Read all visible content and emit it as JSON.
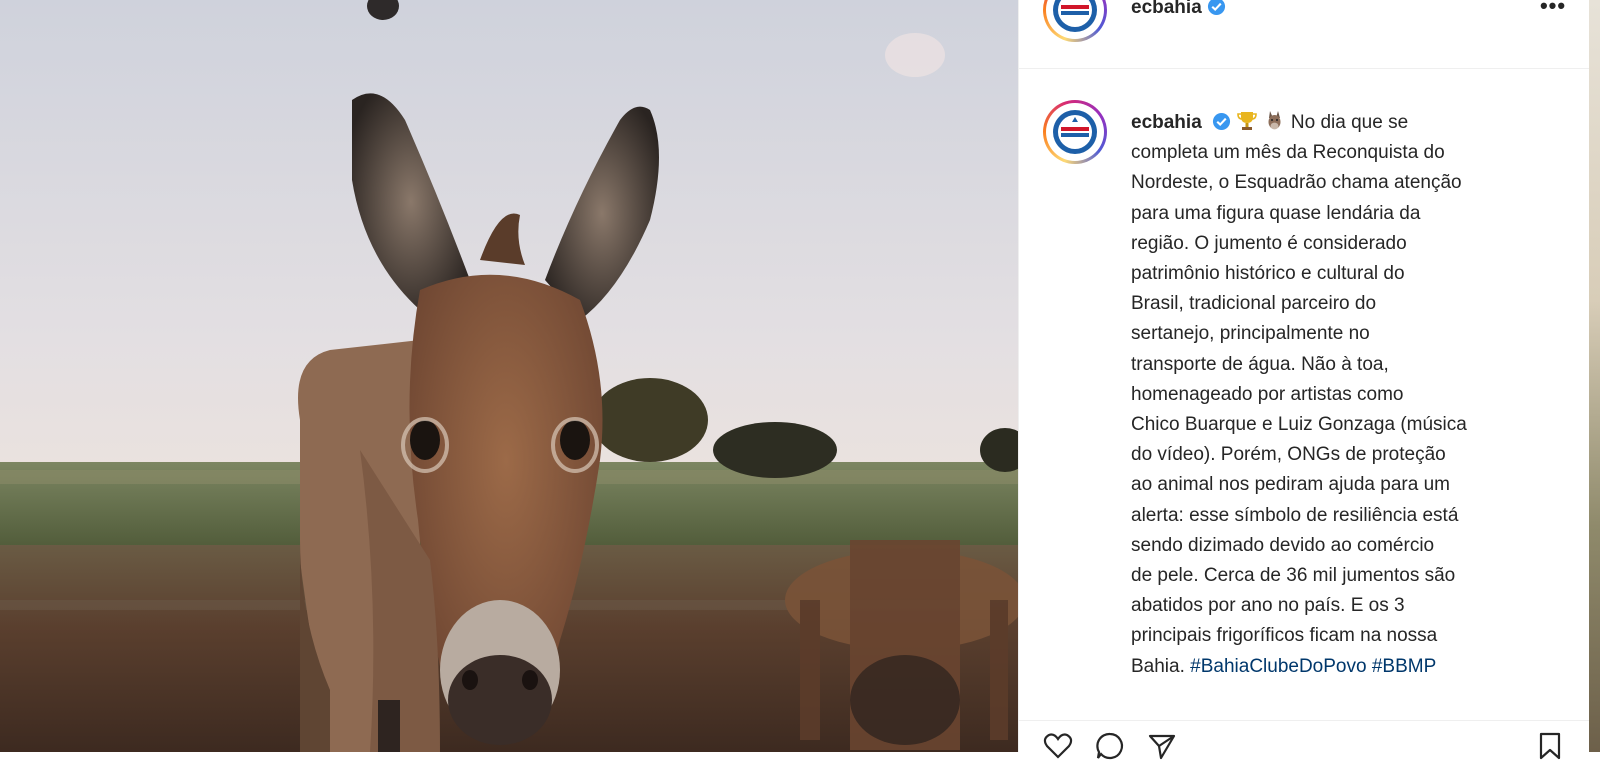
{
  "post": {
    "image_subject": "donkey-photo",
    "account": {
      "username": "ecbahia",
      "verified": true
    },
    "caption": {
      "username": "ecbahia",
      "emojis": [
        "trophy",
        "donkey"
      ],
      "lines": [
        "No dia que se",
        "completa um mês da Reconquista do",
        "Nordeste, o Esquadrão chama atenção",
        "para uma figura quase lendária da",
        "região. O jumento é considerado",
        "patrimônio histórico e cultural do",
        "Brasil, tradicional parceiro do",
        "sertanejo, principalmente no",
        "transporte de água. Não à toa,",
        "homenageado por artistas como",
        "Chico Buarque e Luiz Gonzaga (música",
        "do vídeo). Porém, ONGs de proteção",
        "ao animal nos pediram ajuda para um",
        "alerta: esse símbolo de resiliência está",
        "sendo dizimado devido ao comércio",
        "de pele. Cerca de 36 mil jumentos são",
        "abatidos por ano no país. E os 3",
        "principais frigoríficos ficam na nossa",
        "Bahia."
      ],
      "hashtags": [
        "#BahiaClubeDoPovo",
        "#BBMP"
      ]
    },
    "actions": [
      "heart-icon",
      "comment-icon",
      "share-icon",
      "bookmark-icon"
    ],
    "more_label": "•••"
  },
  "colors": {
    "verified_blue": "#3897f0",
    "hashtag": "#00376b",
    "text": "#262626"
  }
}
